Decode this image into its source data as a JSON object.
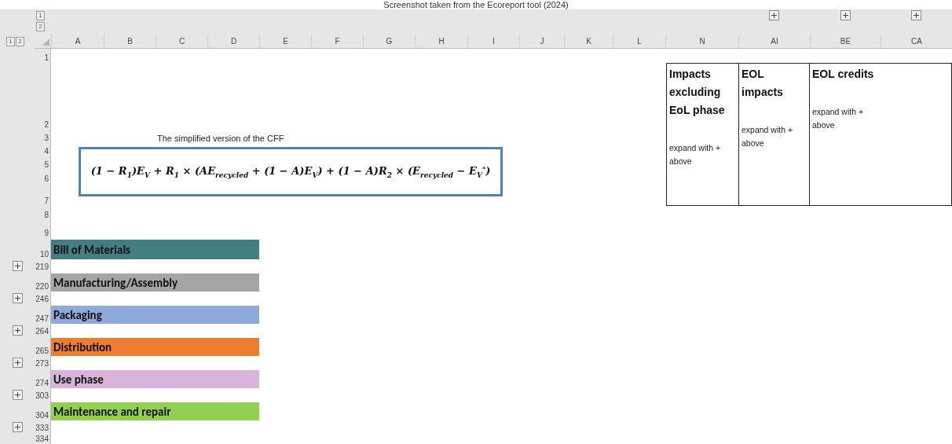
{
  "caption": "Screenshot taken from the Ecoreport tool (2024)",
  "outline_levels": {
    "column": [
      "1",
      "2"
    ],
    "row": [
      "1",
      "2"
    ]
  },
  "columns": [
    {
      "label": "A",
      "collapsed": false
    },
    {
      "label": "B",
      "collapsed": false
    },
    {
      "label": "C",
      "collapsed": false
    },
    {
      "label": "D",
      "collapsed": false
    },
    {
      "label": "E",
      "collapsed": false
    },
    {
      "label": "F",
      "collapsed": false
    },
    {
      "label": "G",
      "collapsed": false
    },
    {
      "label": "H",
      "collapsed": false
    },
    {
      "label": "I",
      "collapsed": false
    },
    {
      "label": "J",
      "collapsed": false
    },
    {
      "label": "K",
      "collapsed": false
    },
    {
      "label": "L",
      "collapsed": false
    },
    {
      "label": "N",
      "collapsed": false
    },
    {
      "label": "AI",
      "collapsed": true
    },
    {
      "label": "BE",
      "collapsed": true
    },
    {
      "label": "CA",
      "collapsed": true
    }
  ],
  "rows": [
    {
      "number": "1",
      "collapsed": false
    },
    {
      "number": "2",
      "collapsed": false
    },
    {
      "number": "3",
      "collapsed": false
    },
    {
      "number": "4",
      "collapsed": false
    },
    {
      "number": "5",
      "collapsed": false
    },
    {
      "number": "6",
      "collapsed": false
    },
    {
      "number": "7",
      "collapsed": false
    },
    {
      "number": "8",
      "collapsed": false
    },
    {
      "number": "9",
      "collapsed": false
    },
    {
      "number": "10",
      "collapsed": false,
      "section": {
        "label": "Bill of Materials",
        "color": "#417f82"
      }
    },
    {
      "number": "219",
      "collapsed": true
    },
    {
      "number": "220",
      "collapsed": false,
      "section": {
        "label": "Manufacturing/Assembly",
        "color": "#a5a5a5"
      }
    },
    {
      "number": "246",
      "collapsed": true
    },
    {
      "number": "247",
      "collapsed": false,
      "section": {
        "label": "Packaging",
        "color": "#8eaadb"
      }
    },
    {
      "number": "264",
      "collapsed": true
    },
    {
      "number": "265",
      "collapsed": false,
      "section": {
        "label": "Distribution",
        "color": "#ed7d31"
      }
    },
    {
      "number": "273",
      "collapsed": true
    },
    {
      "number": "274",
      "collapsed": false,
      "section": {
        "label": "Use phase",
        "color": "#d9b3dc"
      }
    },
    {
      "number": "303",
      "collapsed": true
    },
    {
      "number": "304",
      "collapsed": false,
      "section": {
        "label": "Maintenance and repair",
        "color": "#92d050"
      }
    },
    {
      "number": "333",
      "collapsed": true
    },
    {
      "number": "334",
      "collapsed": false
    }
  ],
  "formula": {
    "label": "The simplified version of the CFF",
    "expression": "(1 − R$_{1}$)E$_{V}$ + R$_{1}$ × (AE$_{recycled}$ + (1 − A)E$_{V}$) + (1 − A)R$_{2}$ × (E$_{recycled}$ − E$_{V}$$^{*}$)"
  },
  "results_table": [
    {
      "title": "Impacts excluding EoL phase",
      "note": "expand with + above"
    },
    {
      "title": "EOL impacts",
      "note": "expand with + above"
    },
    {
      "title": "EOL credits",
      "note": "expand with + above"
    }
  ]
}
